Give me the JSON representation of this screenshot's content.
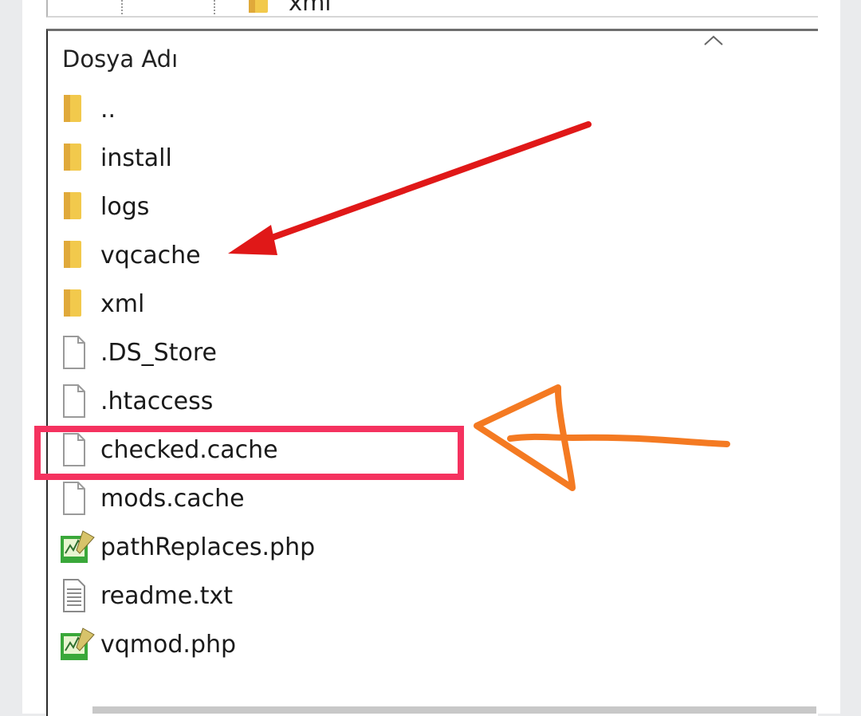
{
  "column_header": "Dosya Adı",
  "top_row": {
    "label": "xml",
    "icon": "folder-icon"
  },
  "files": [
    {
      "name": "..",
      "icon": "folder-icon",
      "type": "folder"
    },
    {
      "name": "install",
      "icon": "folder-icon",
      "type": "folder"
    },
    {
      "name": "logs",
      "icon": "folder-icon",
      "type": "folder"
    },
    {
      "name": "vqcache",
      "icon": "folder-icon",
      "type": "folder"
    },
    {
      "name": "xml",
      "icon": "folder-icon",
      "type": "folder"
    },
    {
      "name": ".DS_Store",
      "icon": "file-icon",
      "type": "file"
    },
    {
      "name": ".htaccess",
      "icon": "file-icon",
      "type": "file"
    },
    {
      "name": "checked.cache",
      "icon": "file-icon",
      "type": "file"
    },
    {
      "name": "mods.cache",
      "icon": "file-icon",
      "type": "file"
    },
    {
      "name": "pathReplaces.php",
      "icon": "php-file-icon",
      "type": "php"
    },
    {
      "name": "readme.txt",
      "icon": "text-file-icon",
      "type": "text"
    },
    {
      "name": "vqmod.php",
      "icon": "php-file-icon",
      "type": "php"
    }
  ],
  "annotations": {
    "red_arrow_target": "vqcache",
    "highlight_box_target": "checked.cache",
    "orange_arrow_target": "checked.cache",
    "colors": {
      "red_arrow": "#e01818",
      "highlight_box": "#f5325f",
      "orange_arrow": "#f47a22"
    }
  }
}
